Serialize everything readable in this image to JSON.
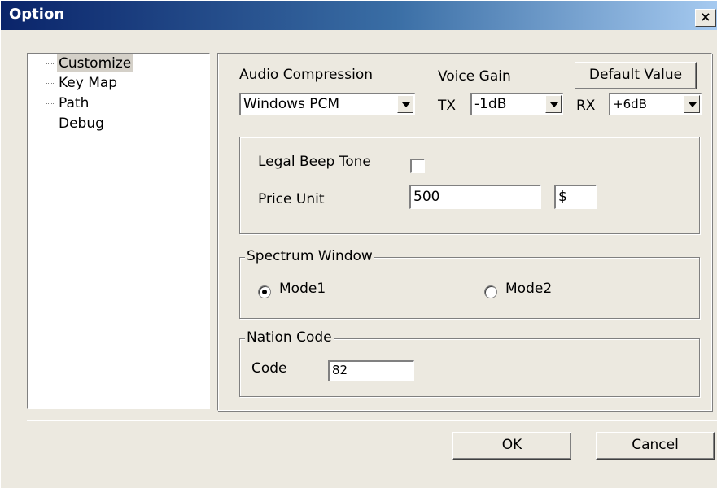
{
  "window": {
    "title": "Option",
    "close_label": "×"
  },
  "tree": {
    "items": [
      {
        "label": "Customize",
        "selected": true
      },
      {
        "label": "Key Map",
        "selected": false
      },
      {
        "label": "Path",
        "selected": false
      },
      {
        "label": "Debug",
        "selected": false
      }
    ]
  },
  "audio": {
    "label": "Audio Compression",
    "value": "Windows PCM"
  },
  "voice_gain": {
    "label": "Voice Gain",
    "tx_label": "TX",
    "tx_value": "-1dB",
    "rx_label": "RX",
    "rx_value": "+6dB"
  },
  "default_value_label": "Default Value",
  "legal": {
    "beep_label": "Legal Beep Tone",
    "beep_checked": false,
    "price_unit_label": "Price Unit",
    "price_value": "500",
    "currency_value": "$"
  },
  "spectrum": {
    "title": "Spectrum Window",
    "mode1_label": "Mode1",
    "mode2_label": "Mode2",
    "selected": "Mode1"
  },
  "nation": {
    "title": "Nation Code",
    "code_label": "Code",
    "code_value": "82"
  },
  "footer": {
    "ok_label": "OK",
    "cancel_label": "Cancel"
  },
  "colors": {
    "dialog_bg": "#ece9e0",
    "title_gradient_start": "#0a246a",
    "title_gradient_end": "#a6caf0",
    "selected_tree_bg": "#d4d0c8"
  },
  "icons": [
    "close-icon",
    "dropdown-arrow-icon",
    "checkbox",
    "radio-button"
  ]
}
